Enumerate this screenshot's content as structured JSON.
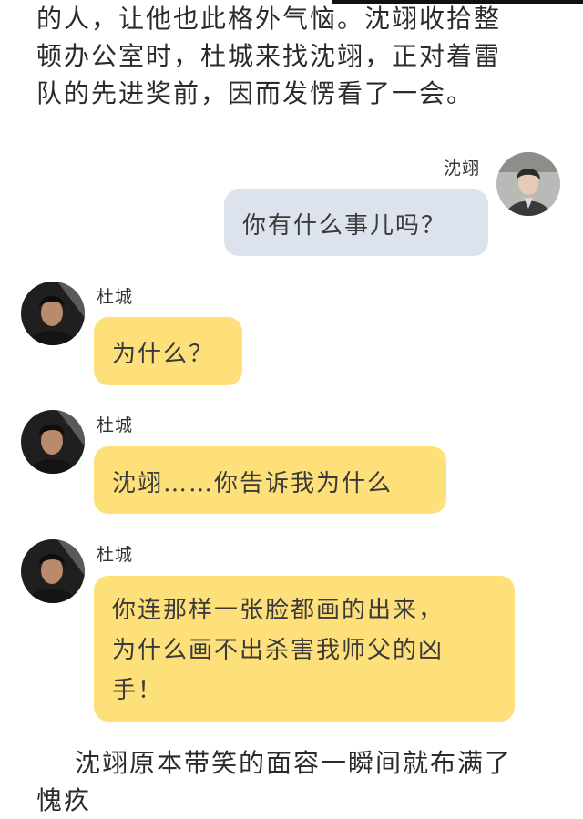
{
  "narration": {
    "top_lines": [
      "的人，让他也此格外气恼。沈翊收拾整",
      "顿办公室时，杜城来找沈翊，正对着雷",
      "队的先进奖前，因而发愣看了一会。"
    ],
    "bottom_lines": [
      "沈翊原本带笑的面容一瞬间就布满了",
      "愧疚"
    ]
  },
  "messages": [
    {
      "sender": "沈翊",
      "text": "你有什么事儿吗？"
    },
    {
      "sender": "杜城",
      "text": "为什么？"
    },
    {
      "sender": "杜城",
      "text": "沈翊……你告诉我为什么"
    },
    {
      "sender": "杜城",
      "lines": [
        "你连那样一张脸都画的出来，",
        "为什么画不出杀害我师父的凶",
        "手！"
      ]
    }
  ],
  "colors": {
    "gray_bubble": "#dde3ec",
    "yellow_bubble": "#fde07a"
  }
}
